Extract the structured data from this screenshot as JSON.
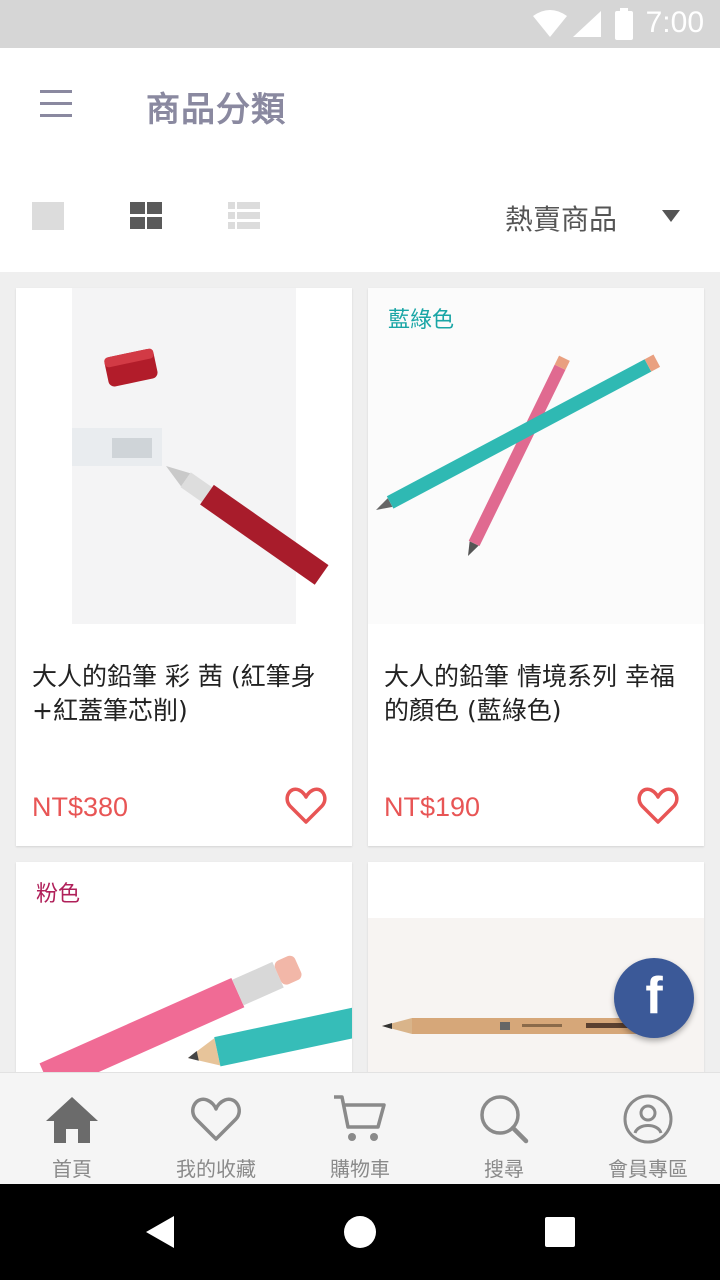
{
  "status_bar": {
    "time": "7:00"
  },
  "header": {
    "title": "商品分類"
  },
  "view_controls": {
    "sort_label": "熱賣商品"
  },
  "products": [
    {
      "name": "大人的鉛筆 彩 茜 (紅筆身+紅蓋筆芯削)",
      "price": "NT$380",
      "variant": ""
    },
    {
      "name": "大人的鉛筆 情境系列 幸福的顏色 (藍綠色)",
      "price": "NT$190",
      "variant": "藍綠色"
    },
    {
      "name": "",
      "price": "",
      "variant": "粉色"
    },
    {
      "name": "",
      "price": "",
      "variant": ""
    }
  ],
  "bottom_nav": [
    {
      "label": "首頁",
      "icon": "home-icon"
    },
    {
      "label": "我的收藏",
      "icon": "heart-icon"
    },
    {
      "label": "購物車",
      "icon": "cart-icon"
    },
    {
      "label": "搜尋",
      "icon": "search-icon"
    },
    {
      "label": "會員專區",
      "icon": "user-icon"
    }
  ],
  "colors": {
    "price": "#e85555",
    "teal_variant": "#1aa6a6",
    "pink_variant": "#b0205a",
    "facebook": "#3b5998"
  }
}
